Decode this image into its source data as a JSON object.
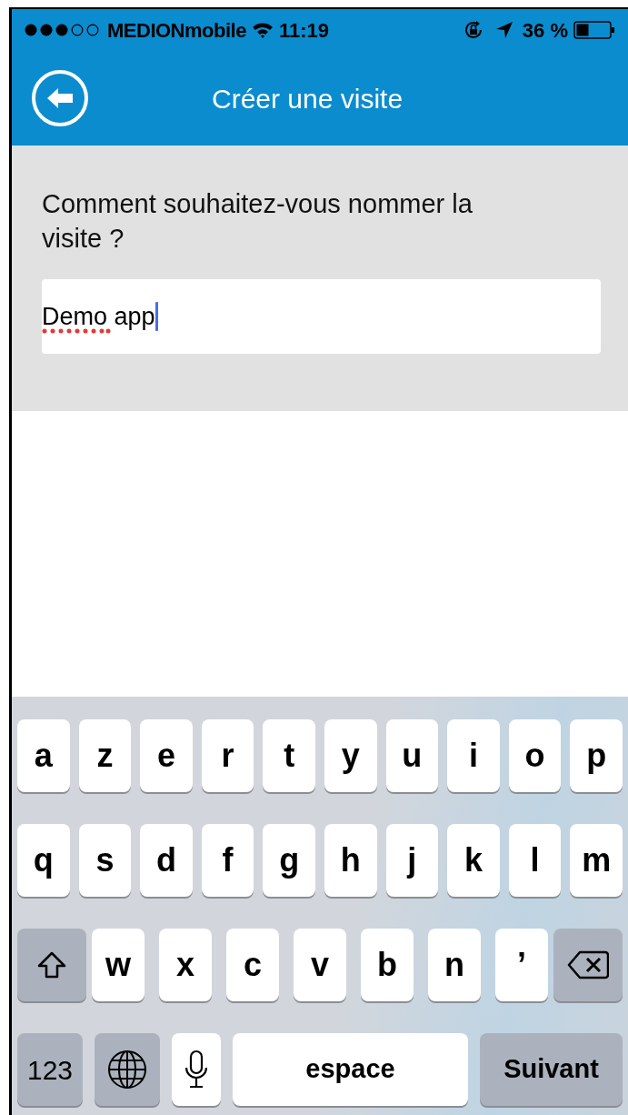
{
  "status_bar": {
    "carrier": "MEDIONmobile",
    "time": "11:19",
    "battery": "36 %"
  },
  "nav": {
    "title": "Créer une visite"
  },
  "form": {
    "question": "Comment souhaitez-vous nommer la visite ?",
    "field": {
      "value": "Demo app",
      "focused": true,
      "spelling_error": true
    }
  },
  "keyboard": {
    "top_row": [
      {
        "kind": "letter",
        "label": "a"
      },
      {
        "kind": "letter",
        "label": "z"
      },
      {
        "kind": "letter",
        "label": "e"
      },
      {
        "kind": "letter",
        "label": "r"
      },
      {
        "kind": "letter",
        "label": "t"
      },
      {
        "kind": "letter",
        "label": "y"
      },
      {
        "kind": "letter",
        "label": "u"
      },
      {
        "kind": "letter",
        "label": "i"
      },
      {
        "kind": "letter",
        "label": "o"
      },
      {
        "kind": "letter",
        "label": "p"
      }
    ],
    "middle_row": [
      {
        "kind": "letter",
        "label": "q"
      },
      {
        "kind": "letter",
        "label": "s"
      },
      {
        "kind": "letter",
        "label": "d"
      },
      {
        "kind": "letter",
        "label": "f"
      },
      {
        "kind": "letter",
        "label": "g"
      },
      {
        "kind": "letter",
        "label": "h"
      },
      {
        "kind": "letter",
        "label": "j"
      },
      {
        "kind": "letter",
        "label": "k"
      },
      {
        "kind": "letter",
        "label": "l"
      },
      {
        "kind": "letter",
        "label": "m"
      }
    ],
    "third_row": [
      {
        "kind": "shift"
      },
      {
        "kind": "letter",
        "label": "w"
      },
      {
        "kind": "letter",
        "label": "x"
      },
      {
        "kind": "letter",
        "label": "c"
      },
      {
        "kind": "letter",
        "label": "v"
      },
      {
        "kind": "letter",
        "label": "b"
      },
      {
        "kind": "letter",
        "label": "n"
      },
      {
        "kind": "letter",
        "label": "’"
      },
      {
        "kind": "backspace"
      }
    ],
    "bottom_row": [
      {
        "kind": "numbers",
        "label": "123"
      },
      {
        "kind": "globe"
      },
      {
        "kind": "mic"
      },
      {
        "kind": "space",
        "label": "espace"
      },
      {
        "kind": "return",
        "label": "Suivant"
      }
    ]
  }
}
